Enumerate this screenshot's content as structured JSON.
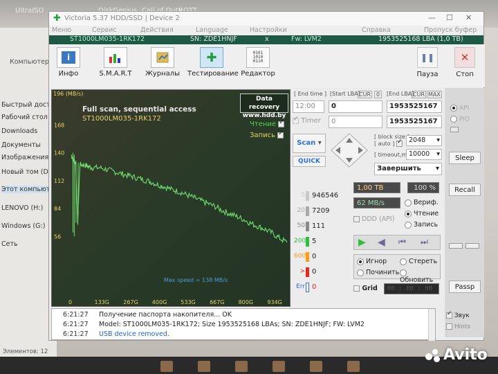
{
  "desktop": {
    "top_items": [
      "UltraISO",
      "DiskGenius",
      "Call of Duty",
      "ROTT"
    ],
    "explorer": {
      "path": "Компьютер",
      "items": [
        "Быстрый доступ",
        "Рабочий стол",
        "Downloads",
        "Документы",
        "Изображения",
        "Новый том (D:)",
        "Этот компьютер",
        "LENOVO (H:)",
        "Windows (G:)",
        "Сеть"
      ]
    },
    "status": "Элементов: 12",
    "watermark": "Avito"
  },
  "window": {
    "title": "Victoria 5.37 HDD/SSD | Device 2",
    "menu": [
      "Меню",
      "Сервис",
      "Действия",
      "Language",
      "Настройки",
      "Справка",
      "Пропуск буфер"
    ],
    "device": {
      "model": "ST1000LM035-1RK172",
      "serial": "SN: ZDE1HNJF",
      "close": "x",
      "firmware": "Fw: LVM2",
      "lba": "1953525168 LBA (1,0 TB)"
    },
    "toolbar": [
      {
        "label": "Инфо",
        "icon": "info-icon"
      },
      {
        "label": "S.M.A.R.T",
        "icon": "smart-chart-icon"
      },
      {
        "label": "Журналы",
        "icon": "journal-icon"
      },
      {
        "label": "Тестирование",
        "icon": "test-plus-icon"
      },
      {
        "label": "Редактор",
        "icon": "hex-editor-icon"
      }
    ],
    "pause_label": "Пауза",
    "stop_label": "Стоп"
  },
  "graph": {
    "ymax_label": "196 (MB/s)",
    "y_labels": [
      "168",
      "140",
      "112",
      "84",
      "56"
    ],
    "x_labels": [
      "0",
      "133G",
      "267G",
      "400G",
      "533G",
      "667G",
      "800G",
      "934G"
    ],
    "heading": "Full scan, sequential access",
    "model": "ST1000LM035-1RK172",
    "data_recovery_line1": "Data recovery",
    "data_recovery_line2": "www.hdd.by",
    "read_label": "Чтение",
    "write_label": "Запись",
    "max_speed": "Max speed = 138 MB/s"
  },
  "controls": {
    "end_time_label": "[ End time ]",
    "start_lba_label": "[Start LBA]",
    "cur_label": "CUR",
    "start_lba_value": "0",
    "start_lba_small": "0",
    "end_lba_label": "[End LBA]",
    "max_label": "MAX",
    "end_time_value": "12:00",
    "timer_label": "Timer",
    "start_lba_field2": "0",
    "end_lba_value": "1953525167",
    "end_lba_value2": "1953525167",
    "block_size_label": "[ block size ]",
    "auto_label": "[ auto ]",
    "block_size_value": "2048",
    "timeout_label": "[ timeout,ms ]",
    "timeout_value": "10000",
    "scan_label": "Scan",
    "quick_label": "QUICK",
    "finish_label": "Завершить"
  },
  "blocks": [
    {
      "ms": "5",
      "count": "946546",
      "color": "#c8c8c8"
    },
    {
      "ms": "20",
      "count": "7209",
      "color": "#a9a9a9"
    },
    {
      "ms": "50",
      "count": "111",
      "color": "#8a8a8a"
    },
    {
      "ms": "200",
      "count": "5",
      "color": "#2fbf3c"
    },
    {
      "ms": "600",
      "count": "0",
      "color": "#ff9a1a"
    },
    {
      "ms": ">",
      "count": "0",
      "color": "#e12b1e"
    },
    {
      "ms": "Err",
      "count": "0",
      "color": "#2a6fd6"
    }
  ],
  "stats": {
    "capacity": "1,00 TB",
    "percent": "100",
    "percent_sign": "%",
    "speed": "62 MB/s",
    "verify_label": "Вериф.",
    "read_label": "Чтение",
    "write_label": "Запись",
    "ddd_label": "DDD (API)",
    "ignore_label": "Игнор",
    "erase_label": "Стереть",
    "repair_label": "Починить",
    "refresh_label": "Обновить",
    "grid_label": "Grid",
    "grid_time": "00 : 00 : 00"
  },
  "side": {
    "api_label": "API",
    "pio_label": "PIO",
    "sleep": "Sleep",
    "recall": "Recall",
    "passp": "Passp",
    "sound_label": "Звук",
    "hints_label": "Hints"
  },
  "log": [
    {
      "time": "6:21:27",
      "msg": "Получение паспорта накопителя... OK",
      "blue": false
    },
    {
      "time": "6:21:27",
      "msg": "Model: ST1000LM035-1RK172; Size 1953525168 LBAs; SN: ZDE1HNJF; FW: LVM2",
      "blue": false
    },
    {
      "time": "6:21:27",
      "msg": "USB device removed.",
      "blue": true
    }
  ],
  "chart_data": {
    "type": "line",
    "ylabel": "(MB/s)",
    "ylim": [
      0,
      196
    ],
    "xlim": [
      0,
      1000
    ],
    "x_ticks": [
      "0",
      "133G",
      "267G",
      "400G",
      "533G",
      "667G",
      "800G",
      "934G"
    ],
    "series": [
      {
        "name": "Чтение",
        "x": [
          0,
          10,
          20,
          30,
          40,
          60,
          80,
          100,
          133,
          167,
          200,
          233,
          267,
          300,
          333,
          367,
          400,
          433,
          467,
          500,
          533,
          567,
          600,
          633,
          667,
          700,
          733,
          767,
          800,
          833,
          867,
          900,
          934,
          967,
          1000
        ],
        "y": [
          138,
          133,
          130,
          70,
          128,
          128,
          126,
          125,
          125,
          123,
          121,
          119,
          117,
          115,
          113,
          111,
          108,
          106,
          103,
          101,
          98,
          95,
          92,
          89,
          86,
          82,
          79,
          76,
          73,
          69,
          66,
          63,
          59,
          54,
          50
        ]
      }
    ]
  }
}
